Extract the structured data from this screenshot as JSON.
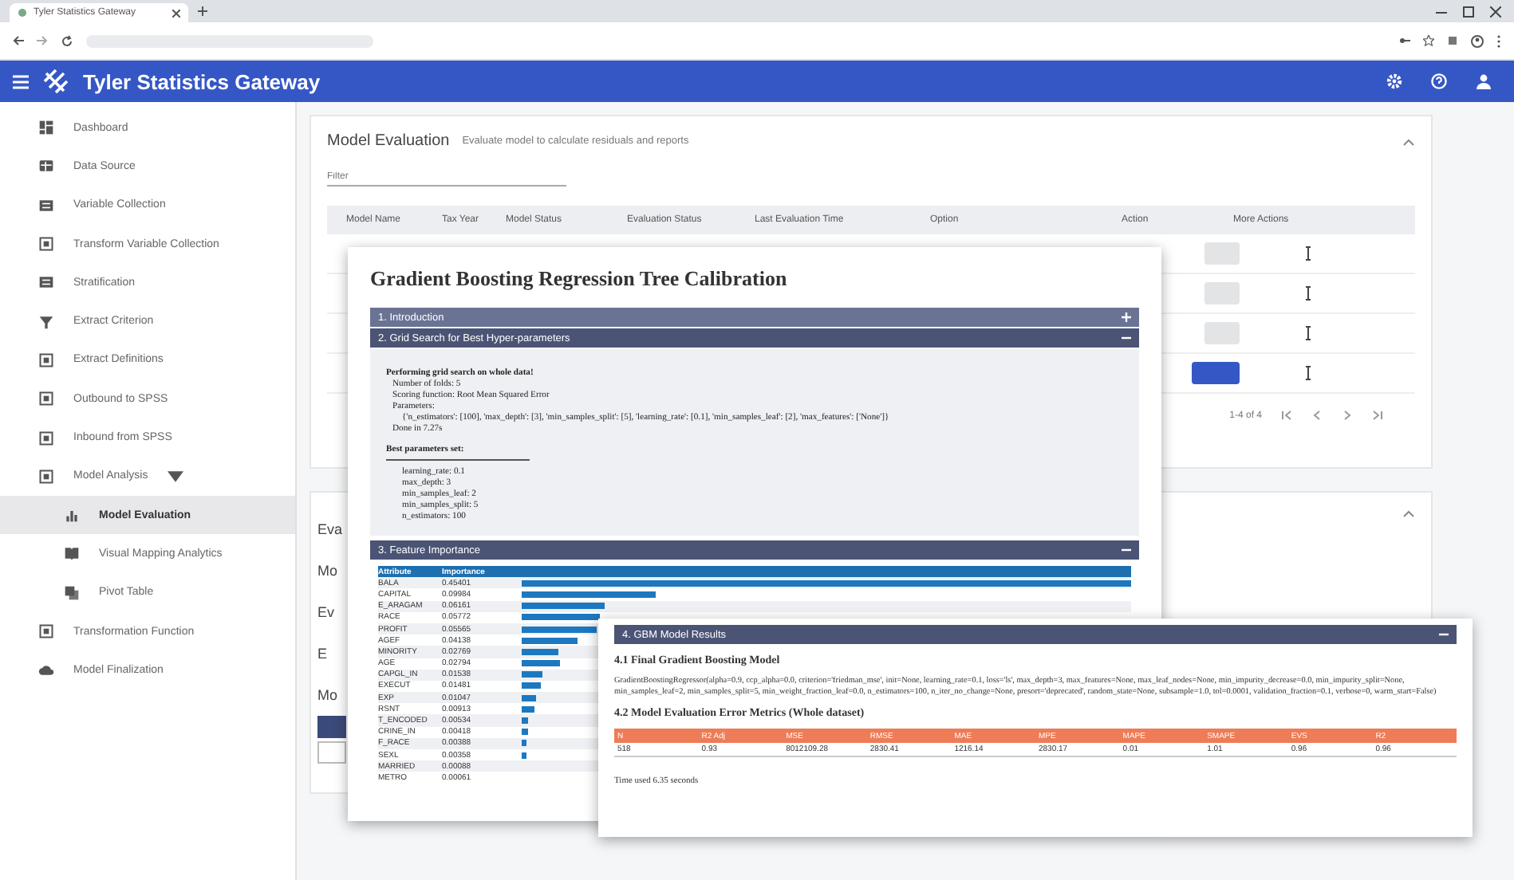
{
  "browser": {
    "tab_title": "Tyler Statistics Gateway"
  },
  "app_bar": {
    "title": "Tyler Statistics Gateway"
  },
  "sidebar": {
    "items": [
      {
        "label": "Dashboard",
        "selected": false
      },
      {
        "label": "Data Source",
        "selected": false
      },
      {
        "label": "Variable Collection",
        "selected": false
      },
      {
        "label": "Transform Variable Collection",
        "selected": false
      },
      {
        "label": "Stratification",
        "selected": false
      },
      {
        "label": "Extract Criterion",
        "selected": false
      },
      {
        "label": "Extract Definitions",
        "selected": false
      },
      {
        "label": "Outbound to SPSS",
        "selected": false
      },
      {
        "label": "Inbound from SPSS",
        "selected": false
      },
      {
        "label": "Model Analysis",
        "selected": false,
        "expanded": true,
        "children": [
          {
            "label": "Model Evaluation",
            "selected": true
          },
          {
            "label": "Visual Mapping Analytics",
            "selected": false
          },
          {
            "label": "Pivot Table",
            "selected": false
          }
        ]
      },
      {
        "label": "Transformation Function",
        "selected": false
      },
      {
        "label": "Model Finalization",
        "selected": false
      }
    ]
  },
  "evaluation_card": {
    "title": "Model Evaluation",
    "subtitle": "Evaluate model to calculate residuals and reports",
    "filter": {
      "placeholder": "Filter"
    },
    "columns": [
      "Model Name",
      "Tax Year",
      "Model Status",
      "Evaluation Status",
      "Last Evaluation Time",
      "Option",
      "Action",
      "More Actions"
    ],
    "rows": [
      {
        "primary": false
      },
      {
        "primary": false
      },
      {
        "primary": false
      },
      {
        "primary": true
      }
    ],
    "pagination": "1-4 of 4"
  },
  "second_card": {
    "fragments": [
      "Eva",
      "Mo",
      "Ev",
      "E",
      "Mo"
    ]
  },
  "calibration_dialog": {
    "title": "Gradient Boosting Regression Tree Calibration",
    "sections": [
      {
        "title": "1. Introduction",
        "expanded": false
      },
      {
        "title": "2. Grid Search for Best Hyper-parameters",
        "expanded": true
      }
    ],
    "grid_search": {
      "heading": "Performing grid search on whole data!",
      "lines": [
        "Number of folds: 5",
        "Scoring function: Root Mean Squared Error",
        "Parameters:",
        "{'n_estimators': [100], 'max_depth': [3], 'min_samples_split': [5], 'learning_rate': [0.1], 'min_samples_leaf': [2], 'max_features': ['None']}",
        "Done in 7.27s"
      ],
      "best_heading": "Best parameters set:",
      "best": [
        "learning_rate: 0.1",
        "max_depth: 3",
        "min_samples_leaf: 2",
        "min_samples_split: 5",
        "n_estimators: 100"
      ]
    },
    "importance_section": {
      "title": "3. Feature Importance",
      "expanded": true
    },
    "importance_columns": [
      "Attribute",
      "Importance"
    ],
    "features": [
      {
        "name": "BALA",
        "value": "0.45401"
      },
      {
        "name": "CAPITAL",
        "value": "0.09984"
      },
      {
        "name": "E_ARAGAM",
        "value": "0.06161"
      },
      {
        "name": "RACE",
        "value": "0.05772"
      },
      {
        "name": "PROFIT",
        "value": "0.05565"
      },
      {
        "name": "AGEF",
        "value": "0.04138"
      },
      {
        "name": "MINORITY",
        "value": "0.02769"
      },
      {
        "name": "AGE",
        "value": "0.02794"
      },
      {
        "name": "CAPGL_IN",
        "value": "0.01538"
      },
      {
        "name": "EXECUT",
        "value": "0.01481"
      },
      {
        "name": "EXP",
        "value": "0.01047"
      },
      {
        "name": "RSNT",
        "value": "0.00913"
      },
      {
        "name": "T_ENCODED",
        "value": "0.00534"
      },
      {
        "name": "CRINE_IN",
        "value": "0.00418"
      },
      {
        "name": "F_RACE",
        "value": "0.00388"
      },
      {
        "name": "SEXL",
        "value": "0.00358"
      },
      {
        "name": "MARRIED",
        "value": "0.00088"
      },
      {
        "name": "METRO",
        "value": "0.00061"
      }
    ]
  },
  "results_dialog": {
    "title": "4. GBM Model Results",
    "expanded": true,
    "model_heading": "4.1 Final Gradient Boosting Model",
    "model_text": "GradientBoostingRegressor(alpha=0.9, ccp_alpha=0.0, criterion='friedman_mse', init=None, learning_rate=0.1, loss='ls', max_depth=3, max_features=None, max_leaf_nodes=None, min_impurity_decrease=0.0, min_impurity_split=None, min_samples_leaf=2, min_samples_split=5, min_weight_fraction_leaf=0.0, n_estimators=100, n_iter_no_change=None, presort='deprecated', random_state=None, subsample=1.0, tol=0.0001, validation_fraction=0.1, verbose=0, warm_start=False)",
    "metrics_heading": "4.2 Model Evaluation Error Metrics (Whole dataset)",
    "metric_columns": [
      "N",
      "R2 Adj",
      "MSE",
      "RMSE",
      "MAE",
      "MPE",
      "MAPE",
      "SMAPE",
      "EVS",
      "R2"
    ],
    "metric_values": [
      "518",
      "0.93",
      "8012109.28",
      "2830.41",
      "1216.14",
      "2830.17",
      "0.01",
      "1.01",
      "0.96",
      "0.96"
    ],
    "footer": "Time used 6.35 seconds"
  }
}
